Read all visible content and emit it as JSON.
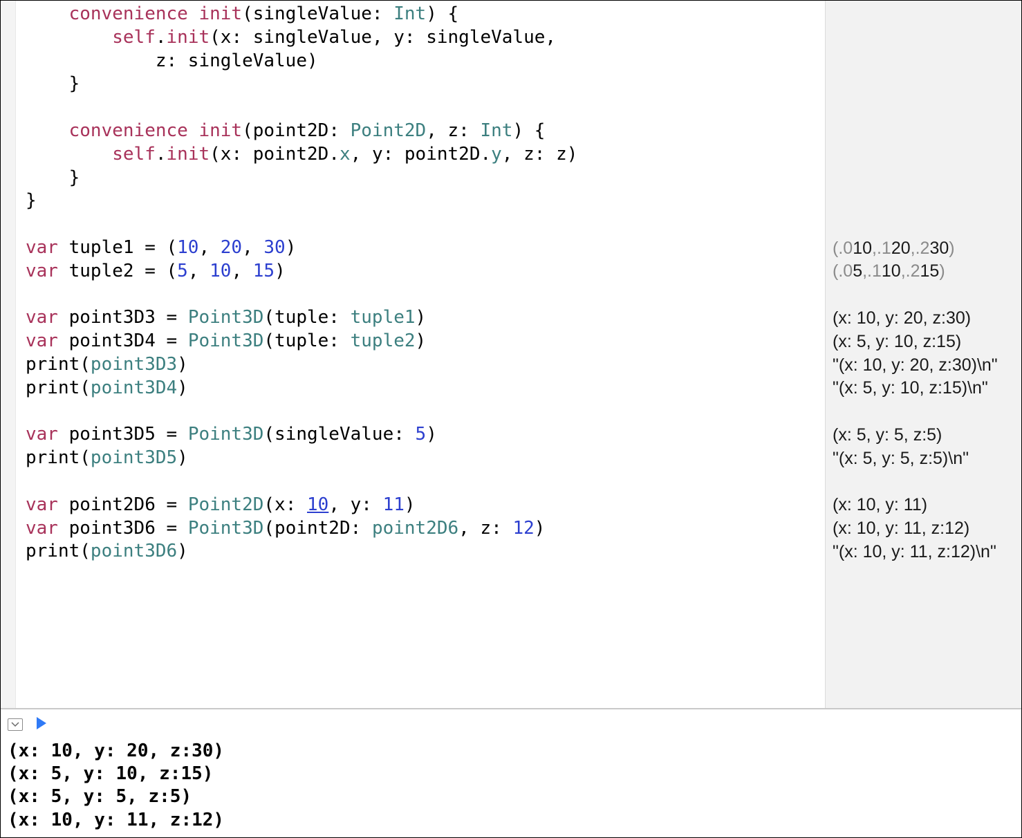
{
  "code": {
    "lines": [
      [
        {
          "class": "",
          "t": "    "
        },
        {
          "class": "kw",
          "t": "convenience"
        },
        {
          "class": "",
          "t": " "
        },
        {
          "class": "kw",
          "t": "init"
        },
        {
          "class": "",
          "t": "(singleValue: "
        },
        {
          "class": "type",
          "t": "Int"
        },
        {
          "class": "",
          "t": ") {"
        }
      ],
      [
        {
          "class": "",
          "t": "        "
        },
        {
          "class": "selfkw",
          "t": "self"
        },
        {
          "class": "",
          "t": "."
        },
        {
          "class": "kw",
          "t": "init"
        },
        {
          "class": "",
          "t": "(x: singleValue, y: singleValue,"
        }
      ],
      [
        {
          "class": "",
          "t": "            z: singleValue)"
        }
      ],
      [
        {
          "class": "",
          "t": "    }"
        }
      ],
      [
        {
          "class": "",
          "t": ""
        }
      ],
      [
        {
          "class": "",
          "t": "    "
        },
        {
          "class": "kw",
          "t": "convenience"
        },
        {
          "class": "",
          "t": " "
        },
        {
          "class": "kw",
          "t": "init"
        },
        {
          "class": "",
          "t": "(point2D: "
        },
        {
          "class": "type",
          "t": "Point2D"
        },
        {
          "class": "",
          "t": ", z: "
        },
        {
          "class": "type",
          "t": "Int"
        },
        {
          "class": "",
          "t": ") {"
        }
      ],
      [
        {
          "class": "",
          "t": "        "
        },
        {
          "class": "selfkw",
          "t": "self"
        },
        {
          "class": "",
          "t": "."
        },
        {
          "class": "kw",
          "t": "init"
        },
        {
          "class": "",
          "t": "(x: point2D."
        },
        {
          "class": "ident2",
          "t": "x"
        },
        {
          "class": "",
          "t": ", y: point2D."
        },
        {
          "class": "ident2",
          "t": "y"
        },
        {
          "class": "",
          "t": ", z: z)"
        }
      ],
      [
        {
          "class": "",
          "t": "    }"
        }
      ],
      [
        {
          "class": "",
          "t": "}"
        }
      ],
      [
        {
          "class": "",
          "t": ""
        }
      ],
      [
        {
          "class": "kw",
          "t": "var"
        },
        {
          "class": "",
          "t": " tuple1 = ("
        },
        {
          "class": "num",
          "t": "10"
        },
        {
          "class": "",
          "t": ", "
        },
        {
          "class": "num",
          "t": "20"
        },
        {
          "class": "",
          "t": ", "
        },
        {
          "class": "num",
          "t": "30"
        },
        {
          "class": "",
          "t": ")"
        }
      ],
      [
        {
          "class": "kw",
          "t": "var"
        },
        {
          "class": "",
          "t": " tuple2 = ("
        },
        {
          "class": "num",
          "t": "5"
        },
        {
          "class": "",
          "t": ", "
        },
        {
          "class": "num",
          "t": "10"
        },
        {
          "class": "",
          "t": ", "
        },
        {
          "class": "num",
          "t": "15"
        },
        {
          "class": "",
          "t": ")"
        }
      ],
      [
        {
          "class": "",
          "t": ""
        }
      ],
      [
        {
          "class": "kw",
          "t": "var"
        },
        {
          "class": "",
          "t": " point3D3 = "
        },
        {
          "class": "type",
          "t": "Point3D"
        },
        {
          "class": "",
          "t": "(tuple: "
        },
        {
          "class": "ident2",
          "t": "tuple1"
        },
        {
          "class": "",
          "t": ")"
        }
      ],
      [
        {
          "class": "kw",
          "t": "var"
        },
        {
          "class": "",
          "t": " point3D4 = "
        },
        {
          "class": "type",
          "t": "Point3D"
        },
        {
          "class": "",
          "t": "(tuple: "
        },
        {
          "class": "ident2",
          "t": "tuple2"
        },
        {
          "class": "",
          "t": ")"
        }
      ],
      [
        {
          "class": "",
          "t": "print("
        },
        {
          "class": "ident2",
          "t": "point3D3"
        },
        {
          "class": "",
          "t": ")"
        }
      ],
      [
        {
          "class": "",
          "t": "print("
        },
        {
          "class": "ident2",
          "t": "point3D4"
        },
        {
          "class": "",
          "t": ")"
        }
      ],
      [
        {
          "class": "",
          "t": ""
        }
      ],
      [
        {
          "class": "kw",
          "t": "var"
        },
        {
          "class": "",
          "t": " point3D5 = "
        },
        {
          "class": "type",
          "t": "Point3D"
        },
        {
          "class": "",
          "t": "(singleValue: "
        },
        {
          "class": "num",
          "t": "5"
        },
        {
          "class": "",
          "t": ")"
        }
      ],
      [
        {
          "class": "",
          "t": "print("
        },
        {
          "class": "ident2",
          "t": "point3D5"
        },
        {
          "class": "",
          "t": ")"
        }
      ],
      [
        {
          "class": "",
          "t": ""
        }
      ],
      [
        {
          "class": "kw",
          "t": "var"
        },
        {
          "class": "",
          "t": " point2D6 = "
        },
        {
          "class": "type",
          "t": "Point2D"
        },
        {
          "class": "",
          "t": "(x: "
        },
        {
          "class": "num underline",
          "t": "10"
        },
        {
          "class": "",
          "t": ", y: "
        },
        {
          "class": "num",
          "t": "11"
        },
        {
          "class": "",
          "t": ")"
        }
      ],
      [
        {
          "class": "kw",
          "t": "var"
        },
        {
          "class": "",
          "t": " point3D6 = "
        },
        {
          "class": "type",
          "t": "Point3D"
        },
        {
          "class": "",
          "t": "(point2D: "
        },
        {
          "class": "ident2",
          "t": "point2D6"
        },
        {
          "class": "",
          "t": ", z: "
        },
        {
          "class": "num",
          "t": "12"
        },
        {
          "class": "",
          "t": ")"
        }
      ],
      [
        {
          "class": "",
          "t": "print("
        },
        {
          "class": "ident2",
          "t": "point3D6"
        },
        {
          "class": "",
          "t": ")"
        }
      ]
    ]
  },
  "sidebar": {
    "lines": [
      "",
      "",
      "",
      "",
      "",
      "",
      "",
      "",
      "",
      "",
      [
        {
          "t": "(",
          "g": true
        },
        {
          "t": ".0 ",
          "g": true
        },
        {
          "t": "10"
        },
        {
          "t": ", ",
          "g": true
        },
        {
          "t": ".1 ",
          "g": true
        },
        {
          "t": "20"
        },
        {
          "t": ", ",
          "g": true
        },
        {
          "t": ".2 ",
          "g": true
        },
        {
          "t": "30"
        },
        {
          "t": ")",
          "g": true
        }
      ],
      [
        {
          "t": "(",
          "g": true
        },
        {
          "t": ".0 ",
          "g": true
        },
        {
          "t": "5"
        },
        {
          "t": ", ",
          "g": true
        },
        {
          "t": ".1 ",
          "g": true
        },
        {
          "t": "10"
        },
        {
          "t": ", ",
          "g": true
        },
        {
          "t": ".2 ",
          "g": true
        },
        {
          "t": "15"
        },
        {
          "t": ")",
          "g": true
        }
      ],
      "",
      [
        {
          "t": "(x: 10, y: 20, z:30)"
        }
      ],
      [
        {
          "t": "(x: 5, y: 10, z:15)"
        }
      ],
      [
        {
          "t": "\"(x: 10, y: 20, z:30)\\n\""
        }
      ],
      [
        {
          "t": "\"(x: 5, y: 10, z:15)\\n\""
        }
      ],
      "",
      [
        {
          "t": "(x: 5, y: 5, z:5)"
        }
      ],
      [
        {
          "t": "\"(x: 5, y: 5, z:5)\\n\""
        }
      ],
      "",
      [
        {
          "t": "(x: 10, y: 11)"
        }
      ],
      [
        {
          "t": "(x: 10, y: 11, z:12)"
        }
      ],
      [
        {
          "t": "\"(x: 10, y: 11, z:12)\\n\""
        }
      ]
    ]
  },
  "console": {
    "lines": [
      "(x: 10, y: 20, z:30)",
      "(x: 5, y: 10, z:15)",
      "(x: 5, y: 5, z:5)",
      "(x: 10, y: 11, z:12)"
    ]
  }
}
